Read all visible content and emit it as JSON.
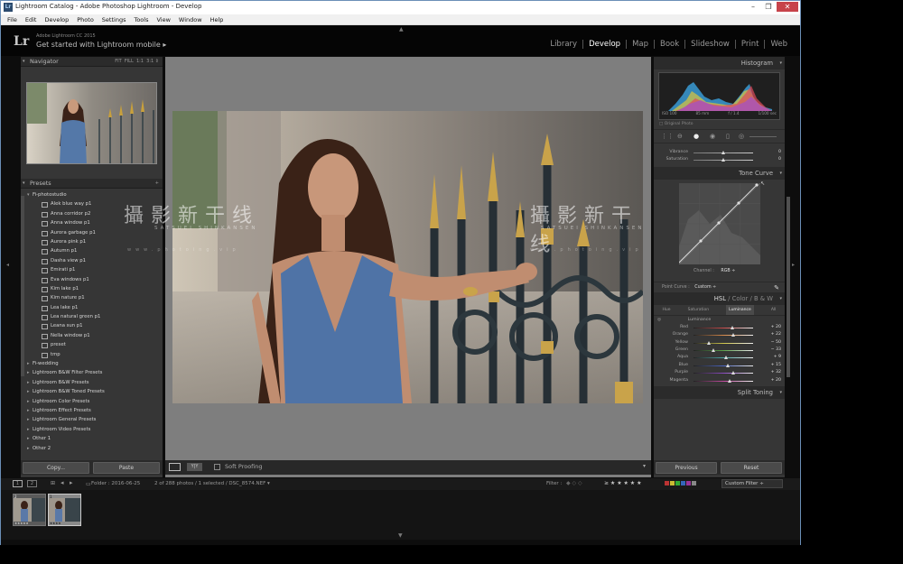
{
  "window": {
    "title": "Lightroom Catalog - Adobe Photoshop Lightroom - Develop",
    "controls": [
      "–",
      "❐",
      "✕"
    ]
  },
  "menu": [
    "File",
    "Edit",
    "Develop",
    "Photo",
    "Settings",
    "Tools",
    "View",
    "Window",
    "Help"
  ],
  "identity": {
    "logo": "Lr",
    "version": "Adobe Lightroom CC 2015",
    "mobile": "Get started with Lightroom mobile ▸"
  },
  "modules": [
    "Library",
    "Develop",
    "Map",
    "Book",
    "Slideshow",
    "Print",
    "Web"
  ],
  "active_module": "Develop",
  "navigator": {
    "title": "Navigator",
    "zoom": [
      "FIT",
      "FILL",
      "1:1",
      "3:1 ⇕"
    ]
  },
  "presets": {
    "title": "Presets",
    "items": [
      {
        "type": "folder-open",
        "label": "Fi-photostudio"
      },
      {
        "type": "item",
        "label": "Alek blue way p1"
      },
      {
        "type": "item",
        "label": "Anna corridor p2"
      },
      {
        "type": "item",
        "label": "Anna window p1"
      },
      {
        "type": "item",
        "label": "Aurora garbage p1"
      },
      {
        "type": "item",
        "label": "Aurora pink p1"
      },
      {
        "type": "item",
        "label": "Autumn p1"
      },
      {
        "type": "item",
        "label": "Dasha view p1"
      },
      {
        "type": "item",
        "label": "Emirati p1"
      },
      {
        "type": "item",
        "label": "Eva windows p1"
      },
      {
        "type": "item",
        "label": "Kim lake p1"
      },
      {
        "type": "item",
        "label": "Kim nature p1"
      },
      {
        "type": "item",
        "label": "Lea lake p1"
      },
      {
        "type": "item",
        "label": "Lea natural green p1"
      },
      {
        "type": "item",
        "label": "Leana sun p1"
      },
      {
        "type": "item",
        "label": "Nella window p1"
      },
      {
        "type": "item",
        "label": "preset"
      },
      {
        "type": "item",
        "label": "tmp"
      },
      {
        "type": "folder",
        "label": "Fi-wedding"
      },
      {
        "type": "folder",
        "label": "Lightroom B&W Filter Presets"
      },
      {
        "type": "folder",
        "label": "Lightroom B&W Presets"
      },
      {
        "type": "folder",
        "label": "Lightroom B&W Toned Presets"
      },
      {
        "type": "folder",
        "label": "Lightroom Color Presets"
      },
      {
        "type": "folder",
        "label": "Lightroom Effect Presets"
      },
      {
        "type": "folder",
        "label": "Lightroom General Presets"
      },
      {
        "type": "folder",
        "label": "Lightroom Video Presets"
      },
      {
        "type": "folder",
        "label": "Other 1"
      },
      {
        "type": "folder",
        "label": "Other 2"
      }
    ]
  },
  "left_buttons": {
    "copy": "Copy...",
    "paste": "Paste"
  },
  "toolbar": {
    "soft_proofing": "Soft Proofing"
  },
  "watermark": {
    "cn": "攝影新干线",
    "en": "SATSUEI SHINKANSEN",
    "url": "www.photoing.vip"
  },
  "histogram": {
    "title": "Histogram",
    "info": [
      "ISO 100",
      "85 mm",
      "f / 1.4",
      "1/100 sec"
    ],
    "original_photo": "Original Photo"
  },
  "basic_tail": [
    {
      "label": "Vibrance",
      "value": "0",
      "pos": 0.5
    },
    {
      "label": "Saturation",
      "value": "0",
      "pos": 0.5
    }
  ],
  "tone_curve": {
    "title": "Tone Curve",
    "channel_label": "Channel :",
    "channel": "RGB ÷",
    "point_curve_label": "Point Curve :",
    "point_curve": "Custom ÷"
  },
  "hsl": {
    "tabs_header": [
      "HSL",
      "Color",
      "B & W"
    ],
    "subtabs": [
      "Hue",
      "Saturation",
      "Luminance",
      "All"
    ],
    "active_subtab": "Luminance",
    "section": "Luminance",
    "rows": [
      {
        "label": "Red",
        "value": "+ 20",
        "color": "#c94a4a",
        "pos": 0.65
      },
      {
        "label": "Orange",
        "value": "+ 22",
        "color": "#d6894a",
        "pos": 0.66
      },
      {
        "label": "Yellow",
        "value": "− 50",
        "color": "#cfc54a",
        "pos": 0.25
      },
      {
        "label": "Green",
        "value": "− 33",
        "color": "#5aa04a",
        "pos": 0.34
      },
      {
        "label": "Aqua",
        "value": "+ 9",
        "color": "#4aa6a6",
        "pos": 0.55
      },
      {
        "label": "Blue",
        "value": "+ 15",
        "color": "#4a64c0",
        "pos": 0.58
      },
      {
        "label": "Purple",
        "value": "+ 32",
        "color": "#8a4ac0",
        "pos": 0.66
      },
      {
        "label": "Magenta",
        "value": "+ 20",
        "color": "#c04a9e",
        "pos": 0.6
      }
    ]
  },
  "split_toning": "Split Toning",
  "right_buttons": {
    "previous": "Previous",
    "reset": "Reset"
  },
  "filmbar": {
    "folder": "Folder : 2016-06-25",
    "count": "2 of 288 photos / 1 selected / DSC_8574.NEF ▾",
    "filter_label": "Filter :",
    "rating": "≥ ★ ★ ★ ★ ★",
    "custom_filter": "Custom Filter ÷",
    "screens": [
      "1",
      "2"
    ]
  },
  "filmstrip": [
    {
      "badge": "2",
      "stars": "★★★★★"
    },
    {
      "badge": "1",
      "stars": "★★★★"
    }
  ]
}
